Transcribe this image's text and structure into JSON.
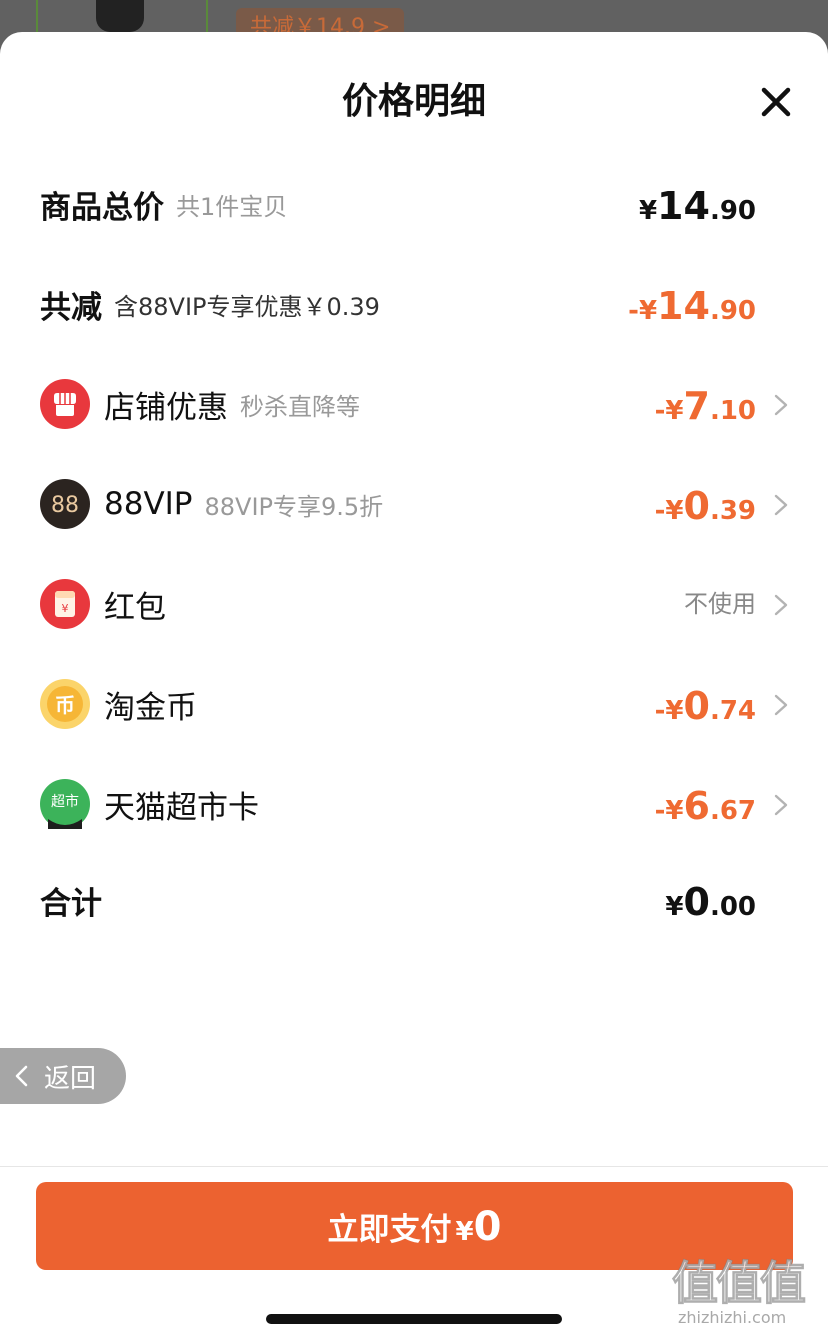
{
  "backdrop": {
    "tag_text": "共减￥14.9 >"
  },
  "sheet": {
    "title": "价格明细",
    "close_icon": "close-icon"
  },
  "rows": {
    "total": {
      "label": "商品总价",
      "sub": "共1件宝贝",
      "currency": "¥",
      "int": "14",
      "dec": ".90"
    },
    "reduce": {
      "label": "共减",
      "sub": "含88VIP专享优惠￥0.39",
      "currency": "-¥",
      "int": "14",
      "dec": ".90"
    },
    "shop": {
      "label": "店铺优惠",
      "sub": "秒杀直降等",
      "currency": "-¥",
      "int": "7",
      "dec": ".10",
      "icon": "shop-icon"
    },
    "vip": {
      "label": "88VIP",
      "sub": "88VIP专享9.5折",
      "currency": "-¥",
      "int": "0",
      "dec": ".39",
      "icon": "88vip-icon",
      "icon_text": "88"
    },
    "redpacket": {
      "label": "红包",
      "status": "不使用",
      "icon": "red-packet-icon",
      "icon_text": "¥"
    },
    "coin": {
      "label": "淘金币",
      "currency": "-¥",
      "int": "0",
      "dec": ".74",
      "icon": "coin-icon",
      "icon_text": "币"
    },
    "card": {
      "label": "天猫超市卡",
      "currency": "-¥",
      "int": "6",
      "dec": ".67",
      "icon": "tmall-supermarket-icon",
      "icon_text": "超市"
    },
    "sum": {
      "label": "合计",
      "currency": "¥",
      "int": "0",
      "dec": ".00"
    }
  },
  "back": {
    "label": "返回"
  },
  "pay": {
    "label": "立即支付",
    "currency": "¥",
    "value": "0"
  },
  "watermark": {
    "glyphs": "值值值",
    "domain": "zhizhizhi.com"
  },
  "colors": {
    "accent": "#ec6230",
    "discount": "#ef6a32",
    "muted": "#999999"
  }
}
